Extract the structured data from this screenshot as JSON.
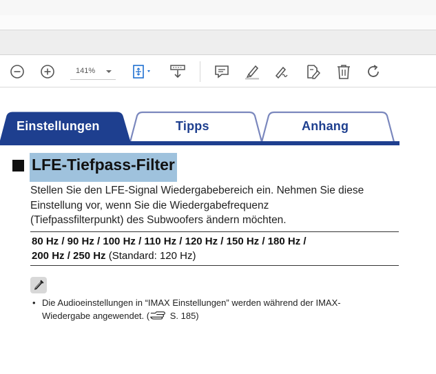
{
  "toolbar": {
    "zoom_value": "141%",
    "icons": [
      "zoom-out-icon",
      "zoom-in-icon",
      "fit-page-icon",
      "scroll-mode-icon",
      "comment-icon",
      "highlight-icon",
      "sign-icon",
      "edit-pdf-icon",
      "delete-icon",
      "rotate-icon"
    ]
  },
  "tabs": {
    "active": "Einstellungen",
    "items": [
      "Einstellungen",
      "Tipps",
      "Anhang"
    ]
  },
  "section": {
    "title": "LFE-Tiefpass-Filter",
    "paragraph": [
      "Stellen Sie den LFE-Signal Wiedergabebereich ein. Nehmen Sie diese",
      "Einstellung vor, wenn Sie die Wiedergabefrequenz",
      "(Tiefpassfilterpunkt) des Subwoofers ändern möchten."
    ],
    "frequencies_line1": "80 Hz / 90 Hz / 100 Hz / 110 Hz / 120 Hz / 150 Hz / 180 Hz /",
    "frequencies_line2_bold": "200 Hz / 250 Hz",
    "frequencies_default": " (Standard: 120 Hz)",
    "note_line1": "Die Audioeinstellungen in “IMAX Einstellungen” werden während der IMAX-",
    "note_line2_prefix": "Wiedergabe angewendet.  (",
    "note_line2_ref": " S. 185)"
  },
  "colors": {
    "tab_active": "#1e3f8f",
    "tab_outline": "#7a87bd",
    "highlight": "#9fc2dd"
  }
}
